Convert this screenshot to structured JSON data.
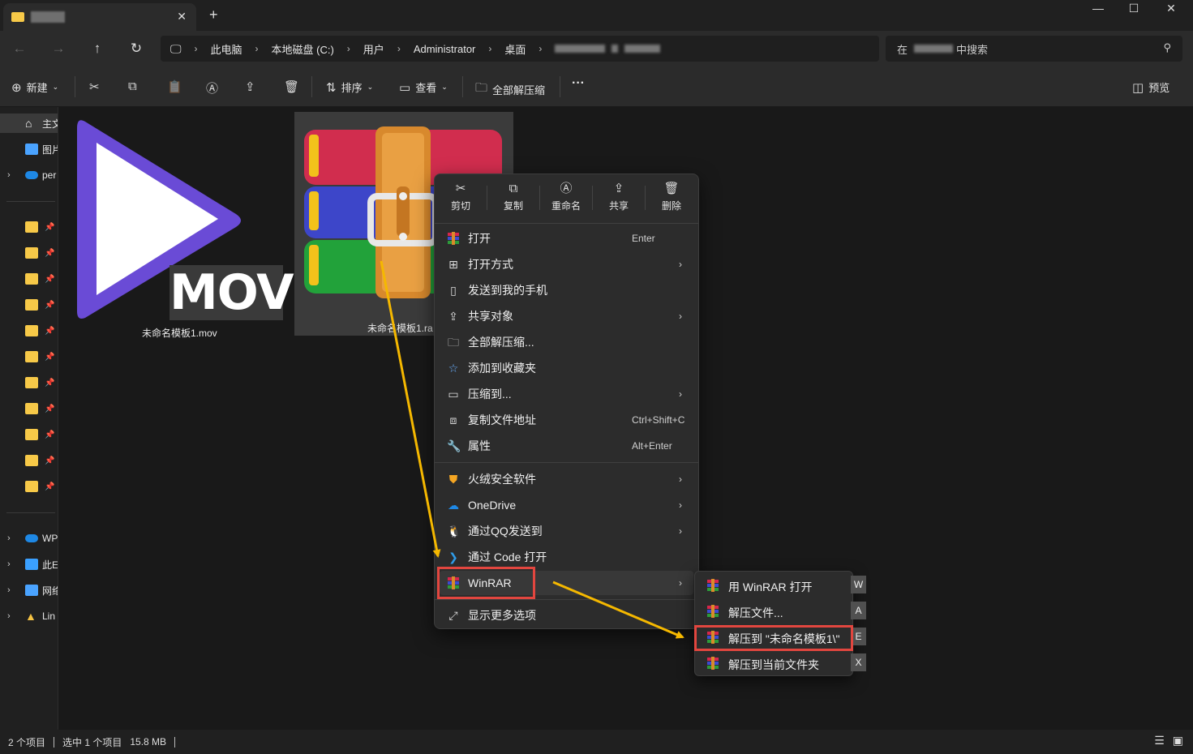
{
  "titlebar": {
    "close_tab": "✕",
    "new_tab": "+",
    "minimize": "—",
    "maximize": "☐",
    "close_window": "✕"
  },
  "nav": {
    "back": "←",
    "forward": "→",
    "up": "↑",
    "refresh": "↻"
  },
  "breadcrumb": [
    "此电脑",
    "本地磁盘 (C:)",
    "用户",
    "Administrator",
    "桌面"
  ],
  "search": {
    "placeholder_pre": "在",
    "placeholder_post": "中搜索"
  },
  "toolbar": {
    "new_label": "新建",
    "sort_label": "排序",
    "view_label": "查看",
    "extract_all_label": "全部解压缩",
    "more_label": "···",
    "preview_label": "预览"
  },
  "sidebar": {
    "items": [
      {
        "label": "主文",
        "color": "#ffffff"
      },
      {
        "label": "图片",
        "color": "#4aa3ff"
      },
      {
        "label": "per",
        "color": "#1e88e5"
      }
    ],
    "bottom_items": [
      {
        "label": "WP",
        "color": "#1e88e5"
      },
      {
        "label": "此E",
        "color": "#3aa0ff"
      },
      {
        "label": "网络",
        "color": "#4aa3ff"
      },
      {
        "label": "Lin",
        "color": "#f6c343"
      }
    ],
    "pinned_count": 11
  },
  "files": [
    {
      "name": "未命名模板1.mov",
      "badge": "MOV"
    },
    {
      "name": "未命名模板1.ra"
    }
  ],
  "context_menu": {
    "quick_actions": [
      {
        "label": "剪切",
        "icon": "scissors-icon"
      },
      {
        "label": "复制",
        "icon": "copy-icon"
      },
      {
        "label": "重命名",
        "icon": "rename-icon"
      },
      {
        "label": "共享",
        "icon": "share-icon"
      },
      {
        "label": "删除",
        "icon": "trash-icon"
      }
    ],
    "items": [
      {
        "label": "打开",
        "shortcut": "Enter",
        "arrow": ""
      },
      {
        "label": "打开方式",
        "shortcut": "",
        "arrow": "›"
      },
      {
        "label": "发送到我的手机",
        "shortcut": "",
        "arrow": ""
      },
      {
        "label": "共享对象",
        "shortcut": "",
        "arrow": "›"
      },
      {
        "label": "全部解压缩...",
        "shortcut": "",
        "arrow": ""
      },
      {
        "label": "添加到收藏夹",
        "shortcut": "",
        "arrow": ""
      },
      {
        "label": "压缩到...",
        "shortcut": "",
        "arrow": "›"
      },
      {
        "label": "复制文件地址",
        "shortcut": "Ctrl+Shift+C",
        "arrow": ""
      },
      {
        "label": "属性",
        "shortcut": "Alt+Enter",
        "arrow": ""
      },
      {
        "label": "火绒安全软件",
        "shortcut": "",
        "arrow": "›"
      },
      {
        "label": "OneDrive",
        "shortcut": "",
        "arrow": "›"
      },
      {
        "label": "通过QQ发送到",
        "shortcut": "",
        "arrow": "›"
      },
      {
        "label": "通过 Code 打开",
        "shortcut": "",
        "arrow": ""
      },
      {
        "label": "WinRAR",
        "shortcut": "",
        "arrow": "›"
      },
      {
        "label": "显示更多选项",
        "shortcut": "",
        "arrow": ""
      }
    ]
  },
  "submenu": {
    "items": [
      {
        "label": "用 WinRAR 打开",
        "key": "W"
      },
      {
        "label": "解压文件...",
        "key": "A"
      },
      {
        "label": "解压到 \"未命名模板1\\\"",
        "key": "E"
      },
      {
        "label": "解压到当前文件夹",
        "key": "X"
      }
    ]
  },
  "status": {
    "item_count": "2 个项目",
    "selected": "选中 1 个项目",
    "size": "15.8 MB"
  },
  "colors": {
    "accent_red": "#e2463f",
    "arrow_yellow": "#f5b800",
    "play_purple": "#6a4bd6"
  }
}
